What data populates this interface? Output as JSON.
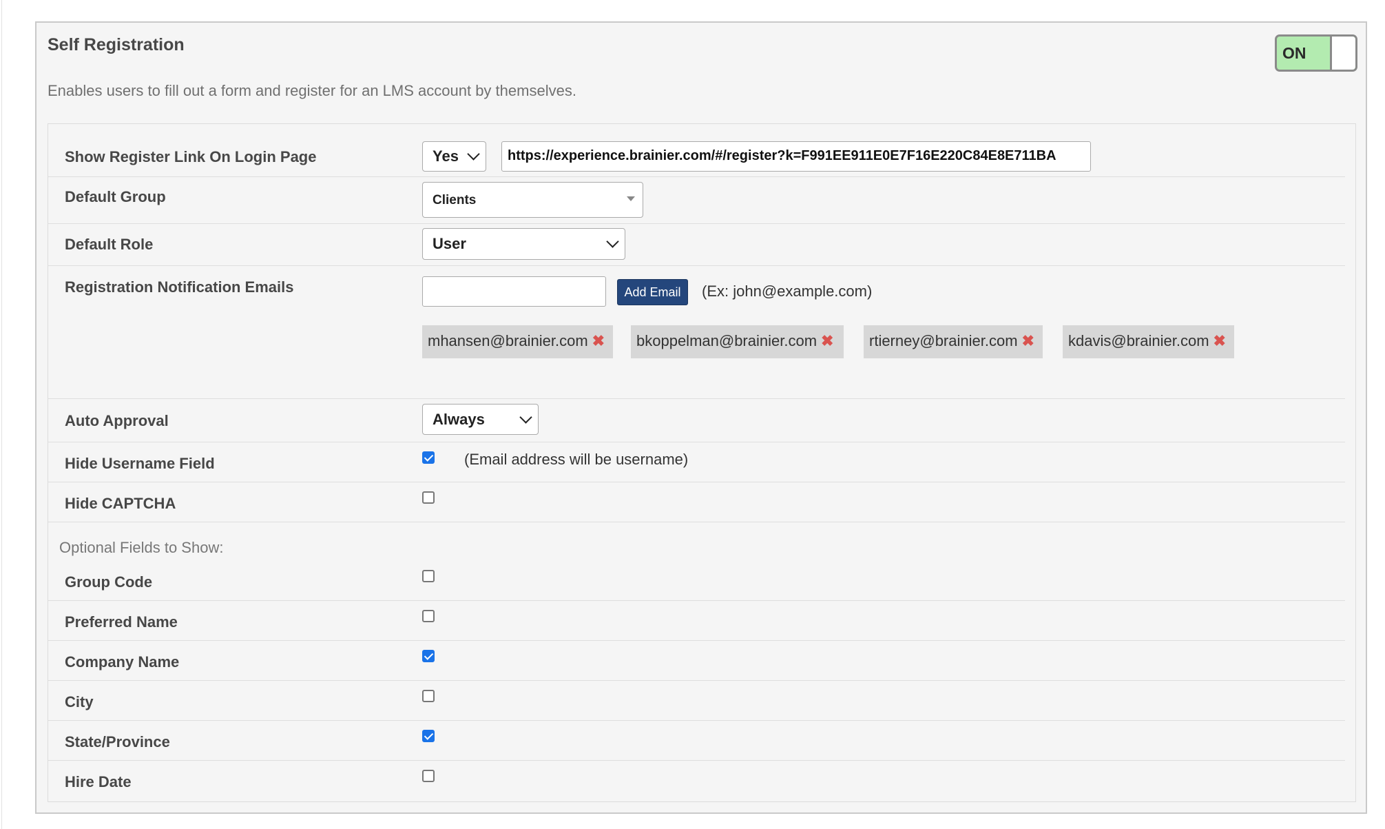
{
  "panel": {
    "title": "Self Registration",
    "description": "Enables users to fill out a form and register for an LMS account by themselves.",
    "toggle": {
      "label": "ON",
      "state": "on",
      "color": "#b3ebb0"
    }
  },
  "settings": {
    "show_register_link": {
      "label": "Show Register Link On Login Page",
      "selected": "Yes",
      "url": "https://experience.brainier.com/#/register?k=F991EE911E0E7F16E220C84E8E711BA"
    },
    "default_group": {
      "label": "Default Group",
      "selected": "Clients"
    },
    "default_role": {
      "label": "Default Role",
      "selected": "User"
    },
    "notification_emails": {
      "label": "Registration Notification Emails",
      "input_value": "",
      "add_button": "Add Email",
      "hint": "(Ex: john@example.com)",
      "emails": [
        "mhansen@brainier.com",
        "bkoppelman@brainier.com",
        "rtierney@brainier.com",
        "kdavis@brainier.com"
      ],
      "remove_icon": "close-x-icon"
    },
    "auto_approval": {
      "label": "Auto Approval",
      "selected": "Always"
    },
    "hide_username": {
      "label": "Hide Username Field",
      "checked": true,
      "note": "(Email address will be username)"
    },
    "hide_captcha": {
      "label": "Hide CAPTCHA",
      "checked": false
    }
  },
  "optional_fields": {
    "heading": "Optional Fields to Show:",
    "items": [
      {
        "label": "Group Code",
        "checked": false
      },
      {
        "label": "Preferred Name",
        "checked": false
      },
      {
        "label": "Company Name",
        "checked": true
      },
      {
        "label": "City",
        "checked": false
      },
      {
        "label": "State/Province",
        "checked": true
      },
      {
        "label": "Hire Date",
        "checked": false
      }
    ]
  },
  "colors": {
    "button": "#24467c",
    "checkbox_checked": "#1a73e8",
    "remove_x": "#d9534f"
  }
}
